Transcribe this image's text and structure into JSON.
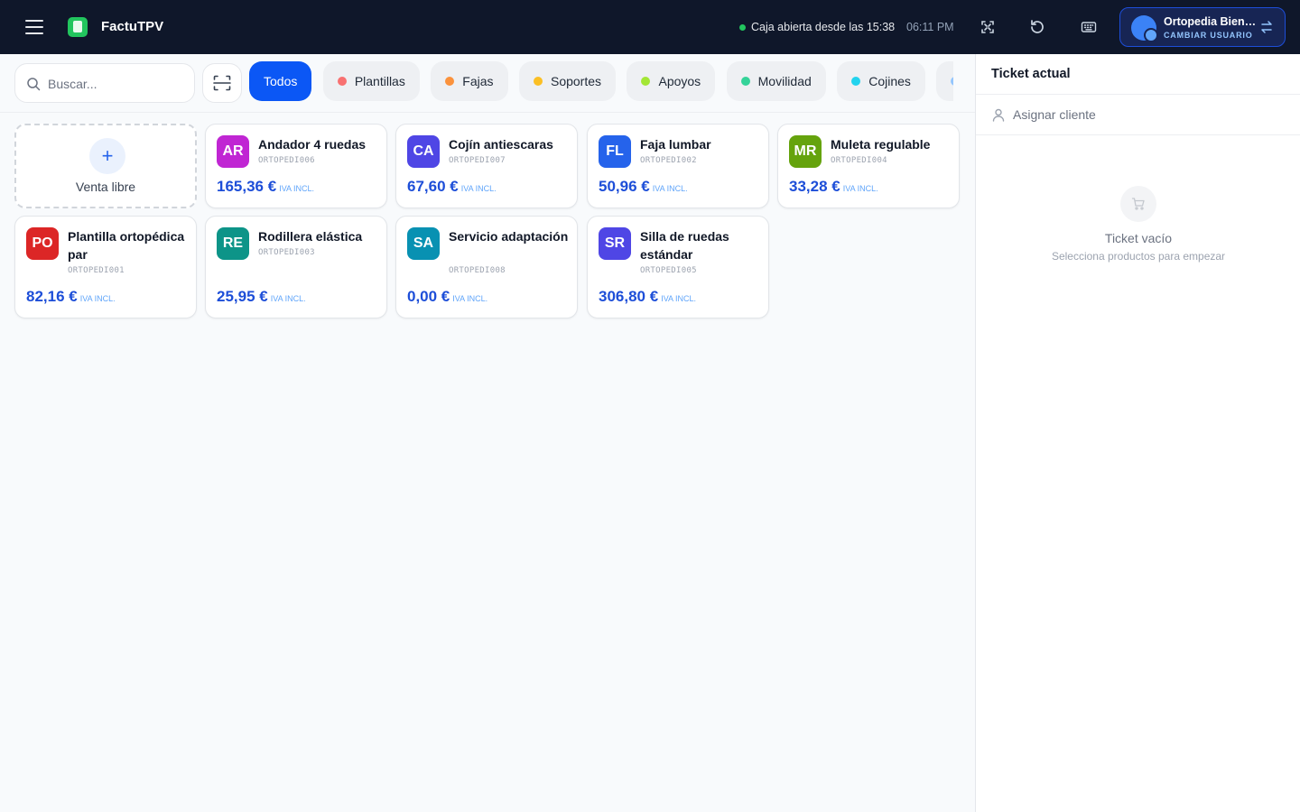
{
  "topbar": {
    "app_title": "FactuTPV",
    "status_text": "Caja abierta desde las 15:38",
    "clock": "06:11 PM",
    "user_name": "Ortopedia Bienestar",
    "user_action": "CAMBIAR USUARIO"
  },
  "search": {
    "placeholder": "Buscar..."
  },
  "categories": [
    {
      "label": "Todos",
      "color": ""
    },
    {
      "label": "Plantillas",
      "color": "#f87171"
    },
    {
      "label": "Fajas",
      "color": "#fb923c"
    },
    {
      "label": "Soportes",
      "color": "#fbbf24"
    },
    {
      "label": "Apoyos",
      "color": "#a3e635"
    },
    {
      "label": "Movilidad",
      "color": "#34d399"
    },
    {
      "label": "Cojines",
      "color": "#22d3ee"
    },
    {
      "label": "",
      "color": "#93c5fd"
    }
  ],
  "free_sale": {
    "label": "Venta libre"
  },
  "products": [
    {
      "initials": "AR",
      "name": "Andador 4 ruedas",
      "code": "ORTOPEDI006",
      "price": "165,36 €",
      "tax": "IVA INCL.",
      "color": "#c026d3"
    },
    {
      "initials": "CA",
      "name": "Cojín antiescaras",
      "code": "ORTOPEDI007",
      "price": "67,60 €",
      "tax": "IVA INCL.",
      "color": "#4f46e5"
    },
    {
      "initials": "FL",
      "name": "Faja lumbar",
      "code": "ORTOPEDI002",
      "price": "50,96 €",
      "tax": "IVA INCL.",
      "color": "#2563eb"
    },
    {
      "initials": "MR",
      "name": "Muleta regulable",
      "code": "ORTOPEDI004",
      "price": "33,28 €",
      "tax": "IVA INCL.",
      "color": "#65a30d"
    },
    {
      "initials": "PO",
      "name": "Plantilla ortopédica par",
      "code": "ORTOPEDI001",
      "price": "82,16 €",
      "tax": "IVA INCL.",
      "color": "#dc2626"
    },
    {
      "initials": "RE",
      "name": "Rodillera elástica",
      "code": "ORTOPEDI003",
      "price": "25,95 €",
      "tax": "IVA INCL.",
      "color": "#0d9488"
    },
    {
      "initials": "SA",
      "name": "Servicio adaptación",
      "code": "ORTOPEDI008",
      "price": "0,00 €",
      "tax": "IVA INCL.",
      "color": "#0891b2"
    },
    {
      "initials": "SR",
      "name": "Silla de ruedas estándar",
      "code": "ORTOPEDI005",
      "price": "306,80 €",
      "tax": "IVA INCL.",
      "color": "#4f46e5"
    }
  ],
  "ticket": {
    "title": "Ticket actual",
    "assign_label": "Asignar cliente",
    "empty_title": "Ticket vacío",
    "empty_subtitle": "Selecciona productos para empezar"
  }
}
